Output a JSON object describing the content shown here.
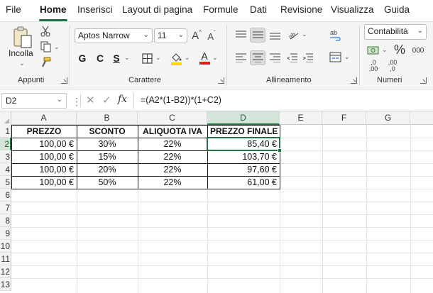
{
  "menu": {
    "items": [
      "File",
      "Home",
      "Inserisci",
      "Layout di pagina",
      "Formule",
      "Dati",
      "Revisione",
      "Visualizza",
      "Guida"
    ],
    "active": "Home"
  },
  "ribbon": {
    "clipboard": {
      "paste_label": "Incolla",
      "group_label": "Appunti"
    },
    "font": {
      "font_name": "Aptos Narrow",
      "font_size": "11",
      "grow_label": "A",
      "shrink_label": "A",
      "bold": "G",
      "italic": "C",
      "underline": "S",
      "font_color_label": "A",
      "group_label": "Carattere"
    },
    "alignment": {
      "group_label": "Allineamento"
    },
    "number": {
      "format": "Contabilità",
      "percent_label": "%",
      "thousands_label": "000",
      "inc_decimals_top": ",0",
      "inc_decimals_bottom": ",00",
      "dec_decimals_top": ",00",
      "dec_decimals_bottom": ",0",
      "group_label": "Numeri"
    }
  },
  "formula_bar": {
    "name_box": "D2",
    "fx": "fx",
    "formula": "=(A2*(1-B2))*(1+C2)"
  },
  "sheet": {
    "columns": [
      "A",
      "B",
      "C",
      "D",
      "E",
      "F",
      "G"
    ],
    "selected_column": "D",
    "rows": [
      "1",
      "2",
      "3",
      "4",
      "5",
      "6",
      "7",
      "8",
      "9",
      "10",
      "11",
      "12",
      "13"
    ],
    "selected_row": "2",
    "headers": [
      "PREZZO",
      "SCONTO",
      "ALIQUOTA IVA",
      "PREZZO FINALE"
    ],
    "data": [
      [
        "100,00 €",
        "30%",
        "22%",
        "85,40 €"
      ],
      [
        "100,00 €",
        "15%",
        "22%",
        "103,70 €"
      ],
      [
        "100,00 €",
        "20%",
        "22%",
        "97,60 €"
      ],
      [
        "100,00 €",
        "50%",
        "22%",
        "61,00 €"
      ]
    ]
  },
  "colors": {
    "accent": "#217346",
    "header_selected_bg": "#d3e5d8"
  }
}
